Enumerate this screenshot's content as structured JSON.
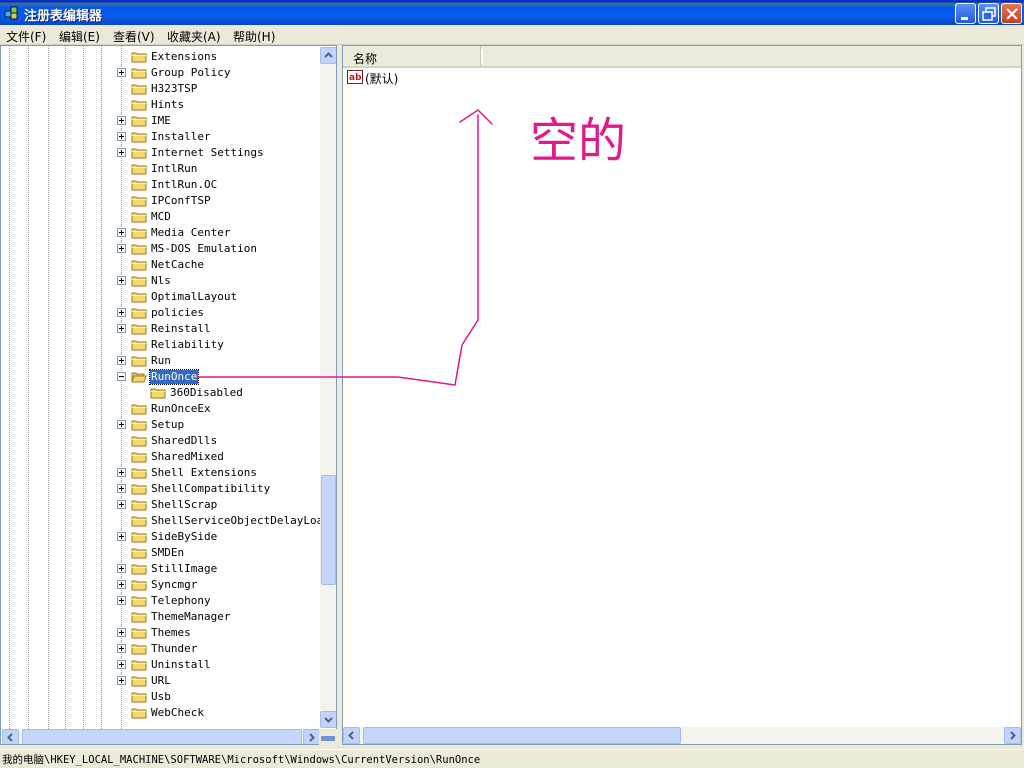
{
  "window": {
    "title": "注册表编辑器",
    "icon": "registry-editor-icon",
    "controls": [
      "minimize-icon",
      "restore-icon",
      "close-icon"
    ]
  },
  "menu": [
    {
      "label": "文件(F)"
    },
    {
      "label": "编辑(E)"
    },
    {
      "label": "查看(V)"
    },
    {
      "label": "收藏夹(A)"
    },
    {
      "label": "帮助(H)"
    }
  ],
  "tree": {
    "items": [
      {
        "label": "Extensions",
        "expandable": false,
        "level": 1
      },
      {
        "label": "Group Policy",
        "expandable": true,
        "level": 1
      },
      {
        "label": "H323TSP",
        "expandable": false,
        "level": 1
      },
      {
        "label": "Hints",
        "expandable": false,
        "level": 1
      },
      {
        "label": "IME",
        "expandable": true,
        "level": 1
      },
      {
        "label": "Installer",
        "expandable": true,
        "level": 1
      },
      {
        "label": "Internet Settings",
        "expandable": true,
        "level": 1
      },
      {
        "label": "IntlRun",
        "expandable": false,
        "level": 1
      },
      {
        "label": "IntlRun.OC",
        "expandable": false,
        "level": 1
      },
      {
        "label": "IPConfTSP",
        "expandable": false,
        "level": 1
      },
      {
        "label": "MCD",
        "expandable": false,
        "level": 1
      },
      {
        "label": "Media Center",
        "expandable": true,
        "level": 1
      },
      {
        "label": "MS-DOS Emulation",
        "expandable": true,
        "level": 1
      },
      {
        "label": "NetCache",
        "expandable": false,
        "level": 1
      },
      {
        "label": "Nls",
        "expandable": true,
        "level": 1
      },
      {
        "label": "OptimalLayout",
        "expandable": false,
        "level": 1
      },
      {
        "label": "policies",
        "expandable": true,
        "level": 1
      },
      {
        "label": "Reinstall",
        "expandable": true,
        "level": 1
      },
      {
        "label": "Reliability",
        "expandable": false,
        "level": 1
      },
      {
        "label": "Run",
        "expandable": true,
        "level": 1
      },
      {
        "label": "RunOnce",
        "expandable": true,
        "expanded": true,
        "selected": true,
        "level": 1
      },
      {
        "label": "360Disabled",
        "expandable": false,
        "level": 2
      },
      {
        "label": "RunOnceEx",
        "expandable": false,
        "level": 1
      },
      {
        "label": "Setup",
        "expandable": true,
        "level": 1
      },
      {
        "label": "SharedDlls",
        "expandable": false,
        "level": 1
      },
      {
        "label": "SharedMixed",
        "expandable": false,
        "level": 1
      },
      {
        "label": "Shell Extensions",
        "expandable": true,
        "level": 1
      },
      {
        "label": "ShellCompatibility",
        "expandable": true,
        "level": 1
      },
      {
        "label": "ShellScrap",
        "expandable": true,
        "level": 1
      },
      {
        "label": "ShellServiceObjectDelayLoad",
        "expandable": false,
        "level": 1
      },
      {
        "label": "SideBySide",
        "expandable": true,
        "level": 1
      },
      {
        "label": "SMDEn",
        "expandable": false,
        "level": 1
      },
      {
        "label": "StillImage",
        "expandable": true,
        "level": 1
      },
      {
        "label": "Syncmgr",
        "expandable": true,
        "level": 1
      },
      {
        "label": "Telephony",
        "expandable": true,
        "level": 1
      },
      {
        "label": "ThemeManager",
        "expandable": false,
        "level": 1
      },
      {
        "label": "Themes",
        "expandable": true,
        "level": 1
      },
      {
        "label": "Thunder",
        "expandable": true,
        "level": 1
      },
      {
        "label": "Uninstall",
        "expandable": true,
        "level": 1
      },
      {
        "label": "URL",
        "expandable": true,
        "level": 1
      },
      {
        "label": "Usb",
        "expandable": false,
        "level": 1
      },
      {
        "label": "WebCheck",
        "expandable": false,
        "level": 1
      }
    ]
  },
  "list": {
    "header_name": "名称",
    "rows": [
      {
        "label": "(默认)",
        "icon": "string-value-icon"
      }
    ]
  },
  "annotation": {
    "text": "空的",
    "color": "#E0198C"
  },
  "status": {
    "path": "我的电脑\\HKEY_LOCAL_MACHINE\\SOFTWARE\\Microsoft\\Windows\\CurrentVersion\\RunOnce"
  },
  "colors": {
    "selection": "#316AC5",
    "titlebar": "#0058EE",
    "folder": "#F5D76E"
  }
}
